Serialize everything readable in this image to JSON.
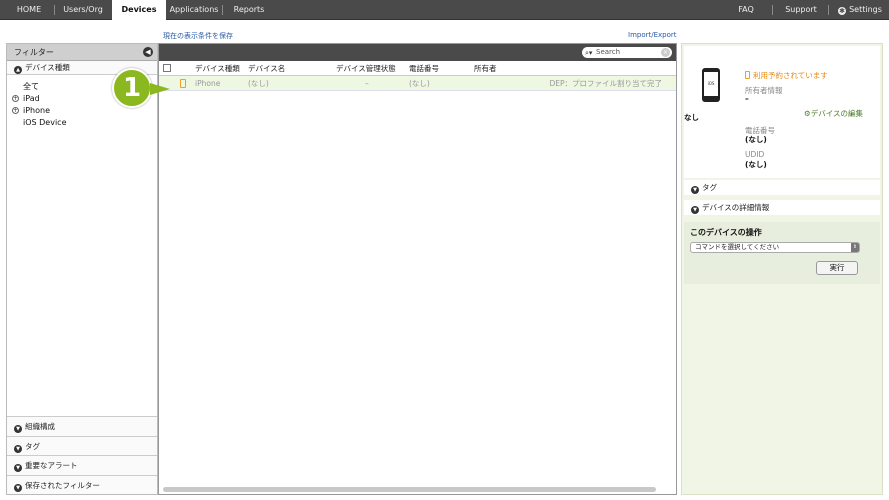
{
  "nav": {
    "tabs": [
      "HOME",
      "Users/Org",
      "Devices",
      "Applications",
      "Reports"
    ],
    "active": "Devices",
    "right": [
      "FAQ",
      "Support",
      "Settings"
    ]
  },
  "links": {
    "save_view": "現在の表示条件を保存",
    "import_export": "Import/Export"
  },
  "filter": {
    "title": "フィルター",
    "device_type_label": "デバイス種類",
    "tree": [
      {
        "label": "全て",
        "expandable": false
      },
      {
        "label": "iPad",
        "expandable": true
      },
      {
        "label": "iPhone",
        "expandable": true
      },
      {
        "label": "iOS Device",
        "expandable": false
      }
    ],
    "bottom_sections": [
      "組織構成",
      "タグ",
      "重要なアラート",
      "保存されたフィルター"
    ]
  },
  "table": {
    "search_placeholder": "Search",
    "columns": [
      "デバイス種類",
      "デバイス名",
      "デバイス管理状態",
      "電話番号",
      "所有者"
    ],
    "rows": [
      {
        "type": "iPhone",
        "name": "(なし)",
        "status": "–",
        "phone": "(なし)",
        "owner": "",
        "note": "DEP：プロファイル割り当て完了"
      }
    ]
  },
  "callout": {
    "number": "1"
  },
  "detail": {
    "device_screen": "iOS",
    "device_name": "なし",
    "reserved": "利用予約されています",
    "owner_label": "所有者情報",
    "owner_value": "–",
    "edit_link": "デバイスの編集",
    "phone_label": "電話番号",
    "phone_value": "(なし)",
    "udid_label": "UDID",
    "udid_value": "(なし)",
    "tag_section": "タグ",
    "details_section": "デバイスの詳細情報",
    "ops_title": "このデバイスの操作",
    "ops_select": "コマンドを選択してください",
    "ops_button": "実行"
  }
}
